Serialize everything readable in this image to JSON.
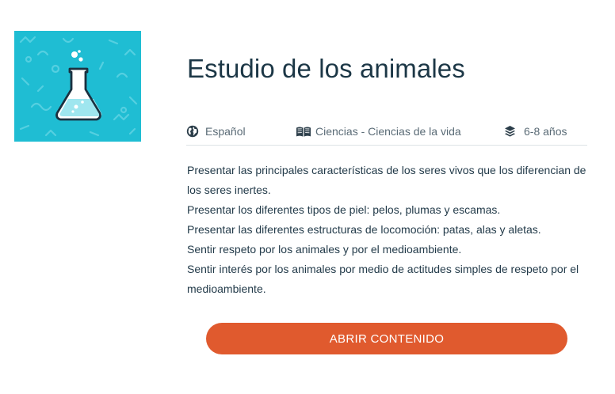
{
  "resource": {
    "title": "Estudio de los animales",
    "thumbnail_icon": "flask-icon",
    "thumbnail_bg": "#1fbdd3"
  },
  "meta": {
    "language": "Español",
    "language_icon": "globe-icon",
    "subject": "Ciencias - Ciencias de la vida",
    "subject_icon": "book-icon",
    "age": "6-8 años",
    "age_icon": "layers-icon"
  },
  "description": [
    "Presentar las principales características de los seres vivos que los diferencian de los seres inertes.",
    "Presentar los diferentes tipos de piel: pelos, plumas y escamas.",
    "Presentar las diferentes estructuras de locomoción: patas, alas y aletas.",
    "Sentir respeto por los animales y por el medioambiente.",
    "Sentir interés por los animales por medio de actitudes simples de respeto por el medioambiente."
  ],
  "actions": {
    "open_label": "ABRIR CONTENIDO",
    "open_color": "#e05a2e"
  }
}
